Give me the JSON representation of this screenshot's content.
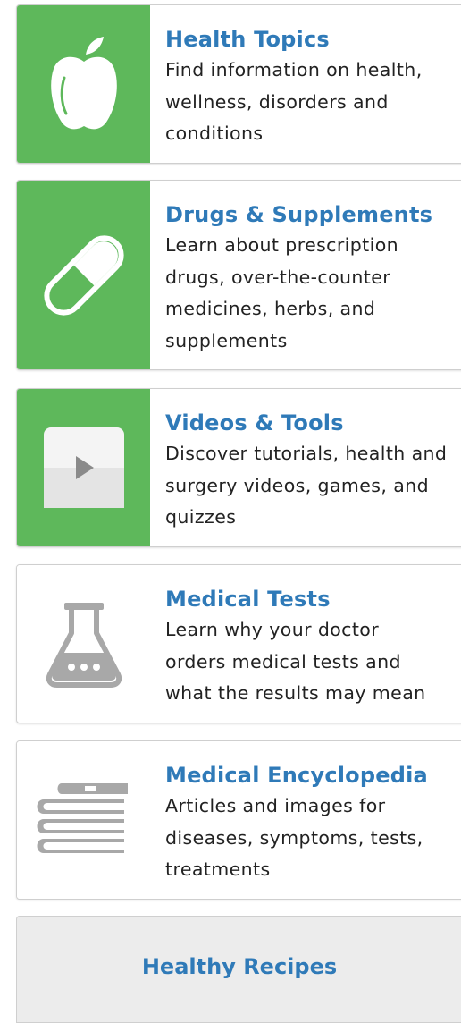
{
  "colors": {
    "accent_green": "#5eb85b",
    "link_blue": "#2f7ab8",
    "icon_gray": "#a8a8a8"
  },
  "cards": [
    {
      "title": "Health Topics",
      "icon": "apple-icon",
      "desc_lines": [
        "Find information on health,",
        "wellness, disorders and",
        "conditions"
      ]
    },
    {
      "title": "Drugs & Supplements",
      "icon": "pill-capsule-icon",
      "desc_lines": [
        "Learn about prescription",
        "drugs, over-the-counter",
        "medicines, herbs, and",
        "supplements"
      ]
    },
    {
      "title": "Videos & Tools",
      "icon": "video-play-icon",
      "desc_lines": [
        "Discover tutorials, health and",
        "surgery videos, games, and",
        "quizzes"
      ]
    },
    {
      "title": "Medical Tests",
      "icon": "lab-flask-icon",
      "desc_lines": [
        "Learn why your doctor",
        "orders medical tests and",
        "what the results may mean"
      ]
    },
    {
      "title": "Medical Encyclopedia",
      "icon": "book-stack-icon",
      "desc_lines": [
        "Articles and images for",
        "diseases, symptoms, tests,",
        "treatments"
      ]
    }
  ],
  "recipes": {
    "label": "Healthy Recipes"
  }
}
